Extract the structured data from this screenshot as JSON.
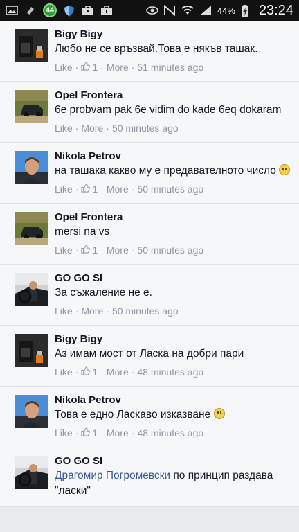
{
  "status_bar": {
    "badge": "44",
    "battery": "44%",
    "time": "23:24"
  },
  "comments": [
    {
      "name": "Bigy Bigy",
      "text": "Любо не се връзвай.Това е някъв ташак.",
      "like": "Like",
      "likes": "1",
      "more": "More",
      "time": "51 minutes ago",
      "avatar": "dark-bottle"
    },
    {
      "name": "Opel Frontera",
      "text": "6е probvam pak 6е vidim do kade 6eq dokaram",
      "like": "Like",
      "more": "More",
      "time": "50 minutes ago",
      "avatar": "suv"
    },
    {
      "name": "Nikola Petrov",
      "text": "на ташака какво му е предавателното число",
      "like": "Like",
      "likes": "1",
      "more": "More",
      "time": "50 minutes ago",
      "avatar": "man"
    },
    {
      "name": "Opel Frontera",
      "text": "mersi na vs",
      "like": "Like",
      "likes": "1",
      "more": "More",
      "time": "50 minutes ago",
      "avatar": "suv"
    },
    {
      "name": "GO GO SI",
      "text": "За съжаление не е.",
      "like": "Like",
      "more": "More",
      "time": "50 minutes ago",
      "avatar": "driver"
    },
    {
      "name": "Bigy Bigy",
      "text": "Аз имам мост от Ласка на добри пари",
      "like": "Like",
      "likes": "1",
      "more": "More",
      "time": "48 minutes ago",
      "avatar": "dark-bottle"
    },
    {
      "name": "Nikola Petrov",
      "text": "Това е едно Ласкаво изказване",
      "like": "Like",
      "likes": "1",
      "more": "More",
      "time": "48 minutes ago",
      "avatar": "man"
    },
    {
      "name": "GO GO SI",
      "mention": "Драгомир Погромевски",
      "text": " по принцип раздава \"ласки\"",
      "avatar": "driver"
    }
  ]
}
